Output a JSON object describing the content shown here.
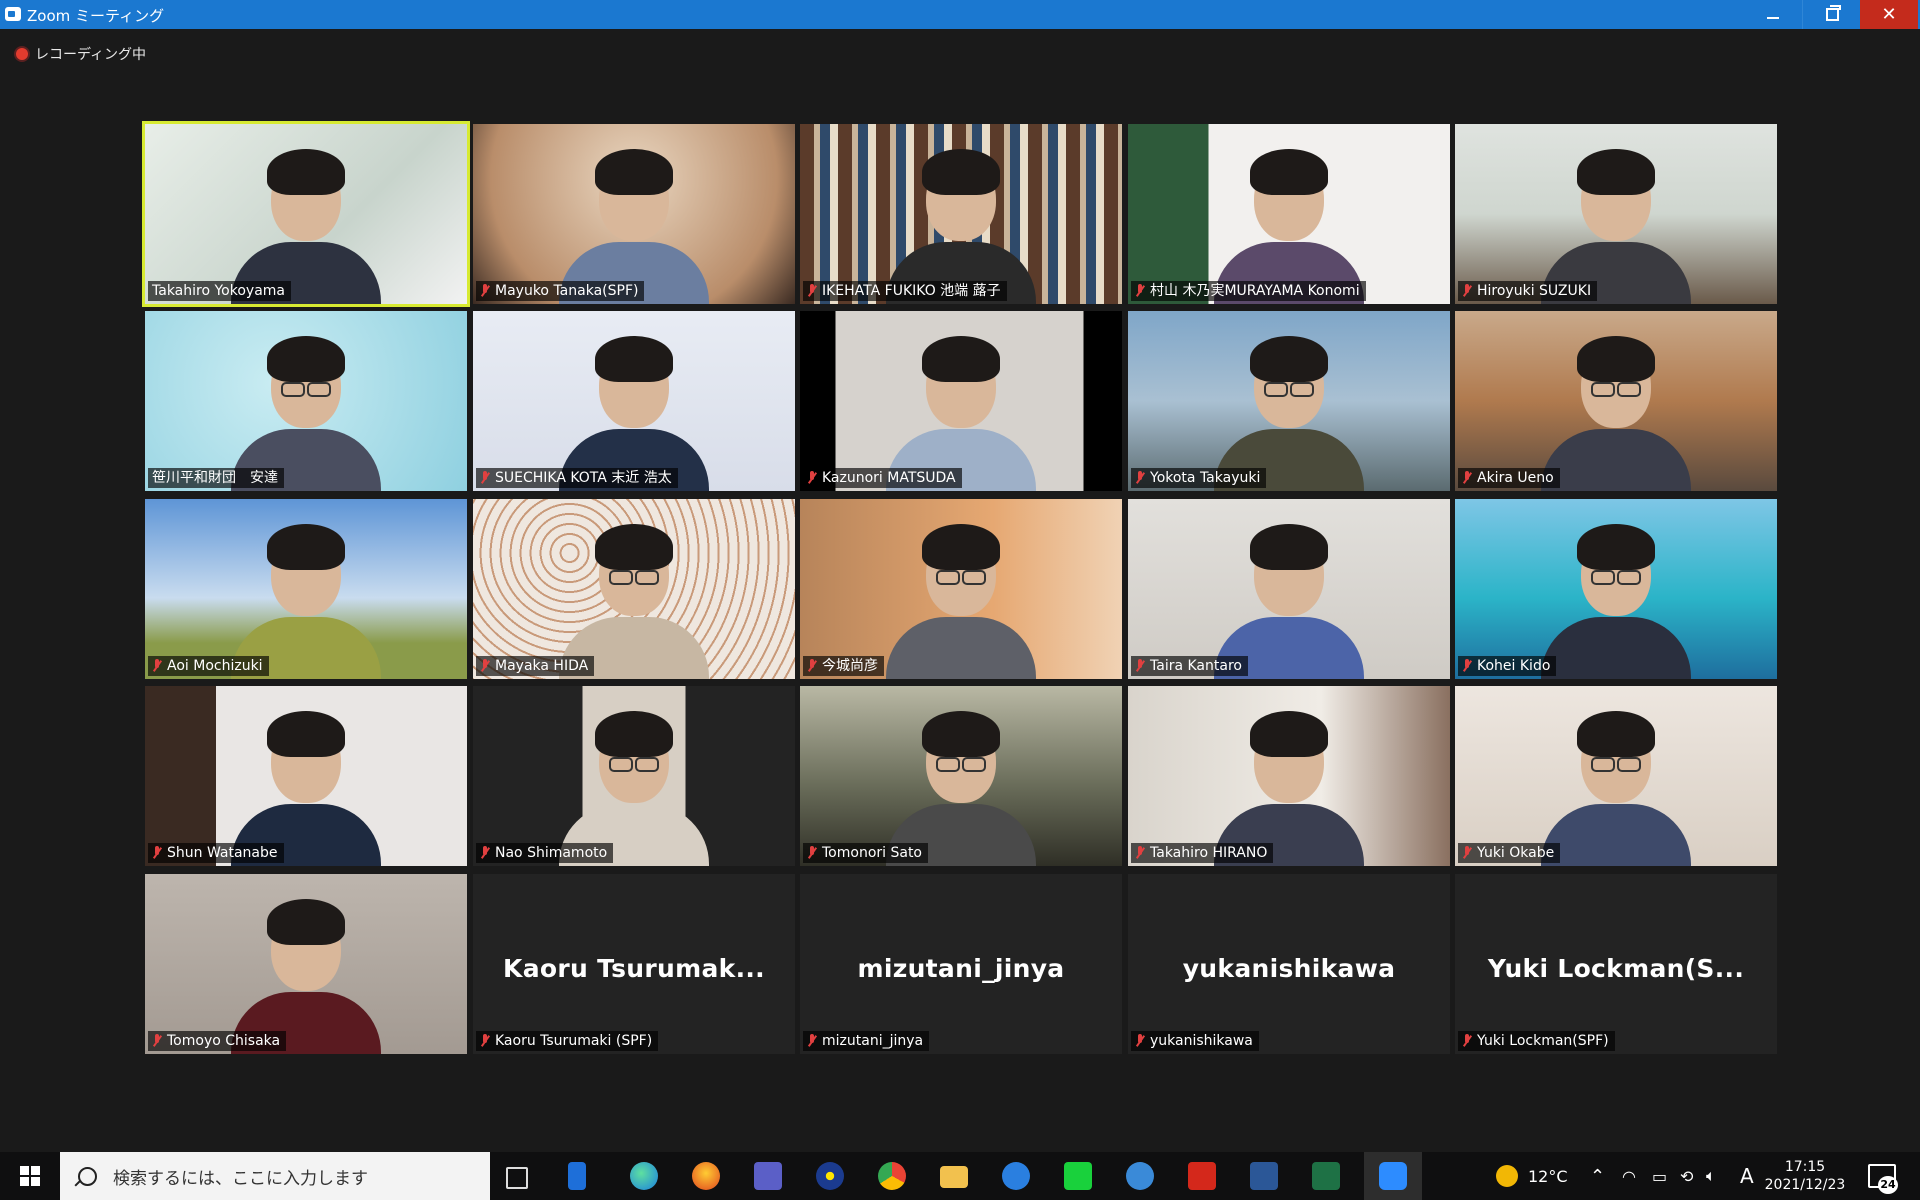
{
  "window": {
    "title": "Zoom ミーティング",
    "accent": "#1b78d0"
  },
  "recording": {
    "label": "レコーディング中"
  },
  "participants": [
    {
      "name": "Takahiro Yokoyama",
      "muted": false,
      "active": true
    },
    {
      "name": "Mayuko Tanaka(SPF)",
      "muted": true
    },
    {
      "name": "IKEHATA FUKIKO 池端 蕗子",
      "muted": true
    },
    {
      "name": "村山 木乃実MURAYAMA Konomi",
      "muted": true
    },
    {
      "name": "Hiroyuki SUZUKI",
      "muted": true
    },
    {
      "name": "笹川平和財団　安達",
      "muted": false
    },
    {
      "name": "SUECHIKA KOTA 末近 浩太",
      "muted": true
    },
    {
      "name": "Kazunori MATSUDA",
      "muted": true
    },
    {
      "name": "Yokota Takayuki",
      "muted": true
    },
    {
      "name": "Akira Ueno",
      "muted": true
    },
    {
      "name": "Aoi Mochizuki",
      "muted": true
    },
    {
      "name": "Mayaka HIDA",
      "muted": true
    },
    {
      "name": "今城尚彦",
      "muted": true
    },
    {
      "name": "Taira Kantaro",
      "muted": true
    },
    {
      "name": "Kohei Kido",
      "muted": true
    },
    {
      "name": "Shun Watanabe",
      "muted": true
    },
    {
      "name": "Nao Shimamoto",
      "muted": true
    },
    {
      "name": "Tomonori Sato",
      "muted": true
    },
    {
      "name": "Takahiro HIRANO",
      "muted": true
    },
    {
      "name": "Yuki Okabe",
      "muted": true
    },
    {
      "name": "Tomoyo Chisaka",
      "muted": true
    },
    {
      "name": "Kaoru Tsurumaki (SPF)",
      "muted": true,
      "display": "Kaoru  Tsurumak..."
    },
    {
      "name": "mizutani_jinya",
      "muted": true,
      "display": "mizutani_jinya"
    },
    {
      "name": "yukanishikawa",
      "muted": true,
      "display": "yukanishikawa"
    },
    {
      "name": "Yuki Lockman(SPF)",
      "muted": true,
      "display": "Yuki  Lockman(S..."
    }
  ],
  "taskbar": {
    "search_placeholder": "検索するには、ここに入力します",
    "weather": "12°C",
    "ime": "A",
    "time": "17:15",
    "date": "2021/12/23",
    "notifications": "24"
  }
}
